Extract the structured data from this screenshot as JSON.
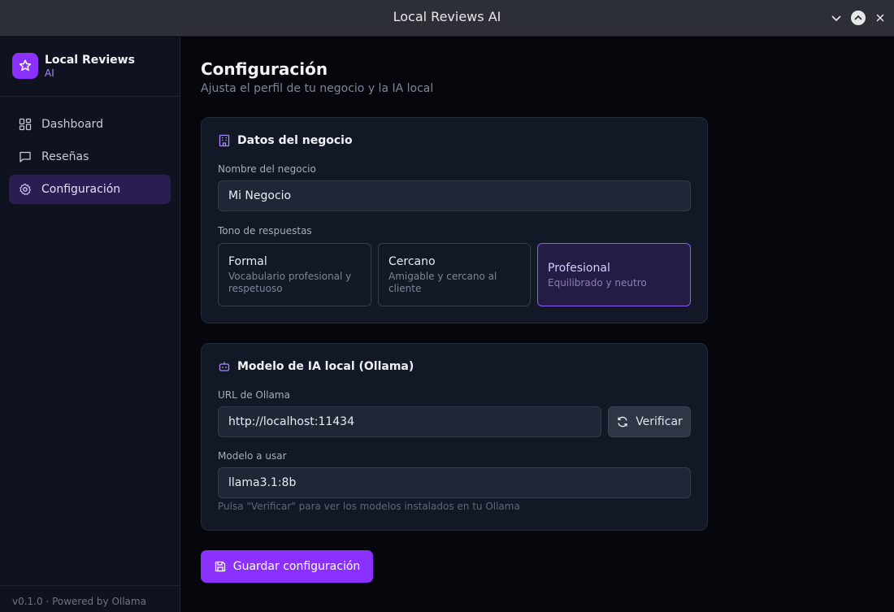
{
  "window": {
    "title": "Local Reviews AI"
  },
  "sidebar": {
    "brand": {
      "name": "Local Reviews",
      "sub": "AI"
    },
    "items": [
      {
        "label": "Dashboard",
        "icon": "dashboard-icon",
        "active": false
      },
      {
        "label": "Reseñas",
        "icon": "message-icon",
        "active": false
      },
      {
        "label": "Configuración",
        "icon": "gear-icon",
        "active": true
      }
    ],
    "footer": "v0.1.0 · Powered by Ollama"
  },
  "page": {
    "title": "Configuración",
    "subtitle": "Ajusta el perfil de tu negocio y la IA local"
  },
  "business": {
    "heading": "Datos del negocio",
    "name_label": "Nombre del negocio",
    "name_value": "Mi Negocio",
    "tone_label": "Tono de respuestas",
    "tones": [
      {
        "name": "Formal",
        "desc": "Vocabulario profesional y respetuoso",
        "selected": false
      },
      {
        "name": "Cercano",
        "desc": "Amigable y cercano al cliente",
        "selected": false
      },
      {
        "name": "Profesional",
        "desc": "Equilibrado y neutro",
        "selected": true
      }
    ]
  },
  "model": {
    "heading": "Modelo de IA local (Ollama)",
    "url_label": "URL de Ollama",
    "url_value": "http://localhost:11434",
    "verify_label": "Verificar",
    "model_label": "Modelo a usar",
    "model_value": "llama3.1:8b",
    "hint": "Pulsa \"Verificar\" para ver los modelos instalados en tu Ollama"
  },
  "save_label": "Guardar configuración",
  "colors": {
    "accent": "#8b31ff",
    "selected_border": "#8b5cf6",
    "background": "#05070d",
    "sidebar": "#0f1320",
    "card": "#121826"
  }
}
